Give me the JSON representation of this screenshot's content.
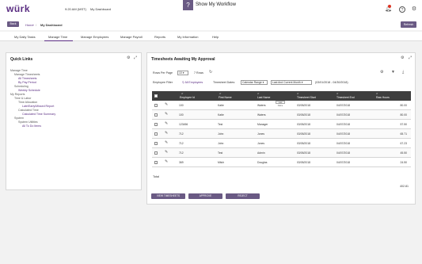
{
  "header": {
    "logo": "würk",
    "time": "9:20 AM (MST)",
    "title": "My Dashboard",
    "workflow_icon": "?",
    "workflow_label": "Show My Workflow",
    "icons": [
      "bell-icon",
      "help-icon",
      "gear-icon"
    ]
  },
  "breadcrumb": {
    "back_label": "Back",
    "home": "Home",
    "separator": "/",
    "current": "My Dashboard",
    "refresh_label": "Refresh"
  },
  "nav": {
    "items": [
      "My Daily Tasks",
      "Manage Time",
      "Manage Employees",
      "Manage Payroll",
      "Reports",
      "My Information",
      "Help"
    ],
    "active_index": 1
  },
  "quick_links": {
    "title": "Quick Links",
    "items": [
      {
        "label": "Manage Time",
        "type": "section"
      },
      {
        "label": "Manage Timesheets",
        "type": "section"
      },
      {
        "label": "All Timesheets",
        "type": "link"
      },
      {
        "label": "By Pay Period",
        "type": "link"
      },
      {
        "label": "Scheduling",
        "type": "section"
      },
      {
        "label": "Weekly Schedule",
        "type": "link"
      },
      {
        "label": "My Reports",
        "type": "section"
      },
      {
        "label": "Time & Labor",
        "type": "section"
      },
      {
        "label": "Time Allocation",
        "type": "section"
      },
      {
        "label": "Late/Early/Missed Report",
        "type": "link"
      },
      {
        "label": "Calculated Time",
        "type": "section"
      },
      {
        "label": "Calculated Time Summary",
        "type": "link"
      },
      {
        "label": "System",
        "type": "section"
      },
      {
        "label": "System Utilities",
        "type": "section"
      },
      {
        "label": "All To Do Items",
        "type": "link"
      }
    ]
  },
  "timesheets": {
    "title": "Timesheets Awaiting My Approval",
    "rows_per_page_label": "Rows Per Page",
    "rows_per_page_value": "10",
    "rows_count": "7 Rows",
    "employee_filter_label": "Employee Filter",
    "employee_filter_value": "All Employees",
    "timesheet_dates_label": "Timesheet Dates:",
    "calendar_range_value": "Calendar Range",
    "date_range_option": "Last And Current Month",
    "date_range_text": "(03/01/2018 - 04/30/2018)",
    "columns": [
      "Employee Id",
      "First Name",
      "Last Name",
      "Timesheet Start",
      "Timesheet End",
      "Raw Hours"
    ],
    "rows": [
      [
        "100",
        "Katie",
        "Waters",
        "03/05/2018",
        "04/07/2018",
        "80.00"
      ],
      [
        "100",
        "Katie",
        "Waters",
        "03/05/2018",
        "04/07/2018",
        "80.00"
      ],
      [
        "123456",
        "Test",
        "Manager",
        "03/05/2018",
        "04/07/2018",
        "57.50"
      ],
      [
        "712",
        "John",
        "Jones",
        "03/05/2018",
        "04/07/2018",
        "65.71"
      ],
      [
        "712",
        "John",
        "Jones",
        "03/05/2018",
        "04/07/2018",
        "67.23"
      ],
      [
        "712",
        "Test",
        "Admin",
        "03/05/2018",
        "04/07/2018",
        "45.50"
      ],
      [
        "369",
        "Mitch",
        "Douglas",
        "03/05/2018",
        "04/07/2018",
        "24.50"
      ]
    ],
    "tooltip": "Last Name",
    "total_label": "Total",
    "total_value": "402.81",
    "buttons": [
      "VIEW TIMESHEETS",
      "APPROVE",
      "REJECT"
    ]
  },
  "colors": {
    "brand": "#5a2d82",
    "button": "#6a5a84",
    "table_header": "#3e3e3e"
  }
}
